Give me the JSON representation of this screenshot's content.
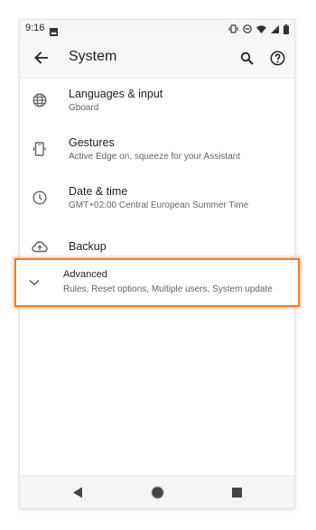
{
  "status_bar": {
    "time": "9:16",
    "icons": [
      "image-icon",
      "vibrate-icon",
      "dnd-icon",
      "wifi-icon",
      "signal-icon",
      "battery-icon"
    ]
  },
  "app_bar": {
    "title": "System",
    "icons": [
      "back-arrow-icon",
      "search-icon",
      "help-icon"
    ]
  },
  "settings": [
    {
      "icon": "globe-icon",
      "title": "Languages & input",
      "subtitle": "Gboard"
    },
    {
      "icon": "gestures-phone-icon",
      "title": "Gestures",
      "subtitle": "Active Edge on, squeeze for your Assistant"
    },
    {
      "icon": "clock-icon",
      "title": "Date & time",
      "subtitle": "GMT+02:00 Central European Summer Time"
    },
    {
      "icon": "cloud-upload-icon",
      "title": "Backup",
      "subtitle": ""
    }
  ],
  "advanced": {
    "icon": "chevron-down-icon",
    "title": "Advanced",
    "subtitle": "Rules, Reset options, Multiple users, System update",
    "highlight_color": "#f37b22"
  },
  "nav_bar": {
    "icons": [
      "nav-back-icon",
      "nav-home-icon",
      "nav-recents-icon"
    ]
  }
}
